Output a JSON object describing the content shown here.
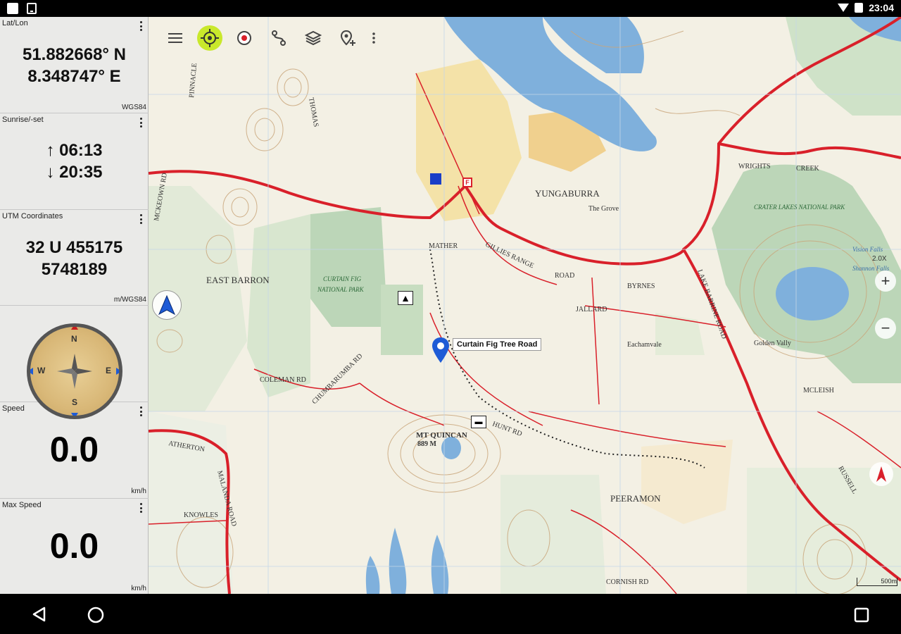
{
  "status_bar": {
    "time": "23:04"
  },
  "toolbar": {
    "buttons": [
      "menu-icon",
      "gps-target-icon",
      "record-icon",
      "route-icon",
      "layers-icon",
      "add-marker-icon",
      "more-icon"
    ]
  },
  "widgets": {
    "latlon": {
      "title": "Lat/Lon",
      "lat": "51.882668° N",
      "lon": "8.348747° E",
      "unit": "WGS84"
    },
    "sun": {
      "title": "Sunrise/-set",
      "rise": "↑ 06:13",
      "set": "↓ 20:35"
    },
    "utm": {
      "title": "UTM Coordinates",
      "zone": "32 U 455175",
      "north": "5748189",
      "unit": "m/WGS84"
    },
    "compass": {
      "n": "N",
      "s": "S",
      "e": "E",
      "w": "W"
    },
    "speed": {
      "title": "Speed",
      "value": "0.0",
      "unit": "km/h"
    },
    "max_speed": {
      "title": "Max Speed",
      "value": "0.0",
      "unit": "km/h"
    }
  },
  "map": {
    "marker_label": "Curtain Fig Tree Road",
    "zoom_level": "2.0X",
    "scale": "500m",
    "places": [
      "YUNGABURRA",
      "EAST BARRON",
      "MT QUINCAN",
      "889 M",
      "PEERAMON",
      "CRATER LAKES NATIONAL PARK",
      "CURTAIN FIG",
      "NATIONAL PARK",
      "GILLIES RANGE",
      "ROAD",
      "JALLARD",
      "ATHERTON",
      "MALANDA ROAD",
      "COLEMAN RD",
      "HUNT RD",
      "LAKE BARRINE ROAD",
      "MCLEISH",
      "CORNISH RD",
      "The Grove",
      "Eachamvale",
      "Golden Vally",
      "WRIGHTS",
      "CREEK",
      "BYRNES",
      "MATHER",
      "RUSSELL",
      "CHUMBARUMBA RD",
      "MCKEOWN RD",
      "PINNACLE",
      "THOMAS",
      "KNOWLES",
      "Vision Falls",
      "Shannon Falls"
    ]
  },
  "nav": {
    "back": "back-icon",
    "home": "home-icon",
    "recents": "recents-icon"
  }
}
